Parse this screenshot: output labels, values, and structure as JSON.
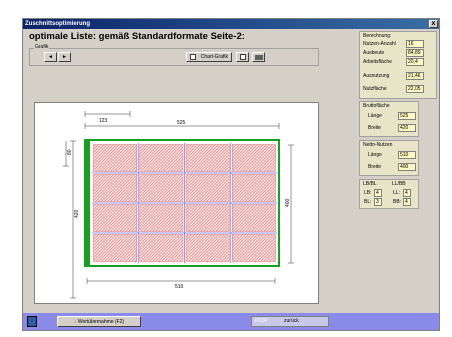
{
  "window": {
    "title": "Zuschnittsoptimierung",
    "close_label": "x"
  },
  "heading": "optimale Liste: gemäß Standardformate Seite-2:",
  "grafik": {
    "group_label": "Grafik",
    "prev_label": "◄",
    "next_label": "►",
    "chart_button_label": "Chart-Grafik"
  },
  "drawing": {
    "dim_top_small": "123",
    "dim_top_total": "525",
    "dim_left_small": "80",
    "dim_left_total": "420",
    "dim_right_total": "400",
    "dim_bottom_total": "510",
    "rows": 4,
    "cols": 4,
    "colors": {
      "frame": "#18a020",
      "hatch": "#e07070",
      "cell_fill": "#fbe8e8",
      "divider": "#6a6af0"
    }
  },
  "berechnung": {
    "title": "Berechnung:",
    "fields": [
      {
        "label": "Nutzen-Anzahl",
        "value": "16"
      },
      {
        "label": "Ausbeute",
        "value": "84,89"
      },
      {
        "label": "Arbeitsfläche",
        "value": "20,4"
      }
    ],
    "extra": [
      {
        "label": "Ausnutzung",
        "value": "21,46"
      },
      {
        "label": "Nutzfläche",
        "value": "22,05"
      }
    ]
  },
  "bruttoflaeche": {
    "title": "Bruttofläche",
    "fields": [
      {
        "label": "Länge",
        "value": "525"
      },
      {
        "label": "Breite",
        "value": "420"
      }
    ]
  },
  "nettonutzen": {
    "title": "Netto-Nutzen",
    "fields": [
      {
        "label": "Länge",
        "value": "510"
      },
      {
        "label": "Breite",
        "value": "400"
      }
    ]
  },
  "lbll": {
    "h1": "LB/BL",
    "h2": "LL/BB",
    "lb_label": "LB:",
    "lb_value": "4",
    "bl_label": "BL:",
    "bl_value": "3",
    "ll_label": "LL:",
    "ll_value": "4",
    "bb_label": "BB:",
    "bb_value": "4"
  },
  "bottom": {
    "accept_label": "Wertübernahme (F2)",
    "field_text": "PDJP",
    "back_label": "zurück"
  }
}
